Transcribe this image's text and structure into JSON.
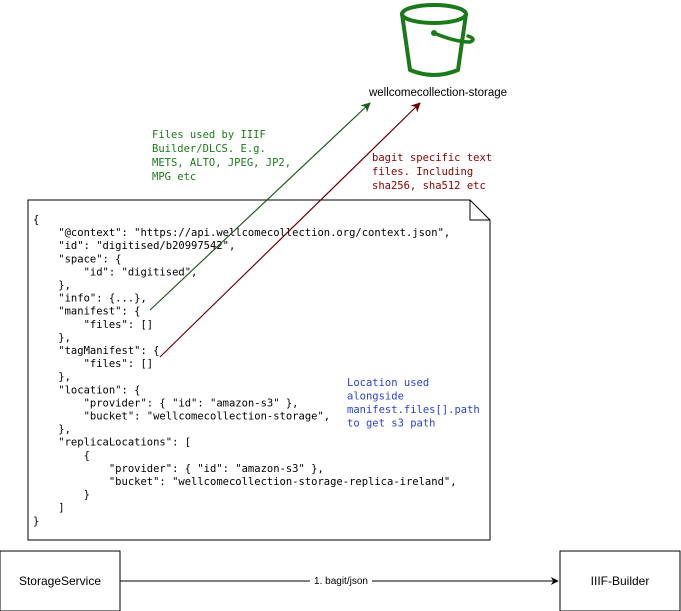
{
  "bucket": {
    "label": "wellcomecollection-storage",
    "icon": "bucket-icon",
    "color": "#1a7a1a"
  },
  "notes": {
    "iiif_files": {
      "lines": [
        "Files used by IIIF",
        "Builder/DLCS. E.g.",
        "METS, ALTO, JPEG, JP2,",
        "MPG etc"
      ],
      "color": "#1a7a1a"
    },
    "bagit_files": {
      "lines": [
        "bagit specific text",
        "files. Including",
        "sha256, sha512 etc"
      ],
      "color": "#8b0000"
    },
    "location": {
      "lines": [
        "Location used",
        "alongside",
        "manifest.files[].path",
        "to get s3 path"
      ],
      "color": "#2a3fd6"
    }
  },
  "json_document": {
    "icon": "document-icon",
    "lines": [
      "{",
      "    \"@context\": \"https://api.wellcomecollection.org/context.json\",",
      "    \"id\": \"digitised/b20997542\",",
      "    \"space\": {",
      "        \"id\": \"digitised\",",
      "    },",
      "    \"info\": {...},",
      "    \"manifest\": {",
      "        \"files\": []",
      "    },",
      "    \"tagManifest\": {",
      "        \"files\": []",
      "    },",
      "    \"location\": {",
      "        \"provider\": { \"id\": \"amazon-s3\" },",
      "        \"bucket\": \"wellcomecollection-storage\",",
      "    },",
      "    \"replicaLocations\": [",
      "        {",
      "            \"provider\": { \"id\": \"amazon-s3\" },",
      "            \"bucket\": \"wellcomecollection-storage-replica-ireland\",",
      "        }",
      "    ]",
      "}"
    ]
  },
  "nodes": {
    "storage_service": "StorageService",
    "iiif_builder": "IIIF-Builder"
  },
  "edge": {
    "label": "1. bagit/json"
  },
  "colors": {
    "green_arrow": "#1a5c1a",
    "red_arrow": "#6b0000",
    "stroke": "#000000"
  }
}
